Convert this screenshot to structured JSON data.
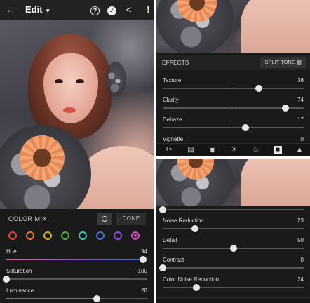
{
  "left": {
    "topbar": {
      "title": "Edit",
      "back_icon": "arrow-left-icon",
      "help_icon": "help-circle-icon",
      "check_icon": "check-circle-icon",
      "share_icon": "share-icon",
      "menu_icon": "more-vertical-icon"
    },
    "color_mix": {
      "title": "COLOR MIX",
      "done_label": "DONE",
      "swatch_colors": [
        "#e0443a",
        "#e5782e",
        "#d6b02a",
        "#4eaa3a",
        "#39c4c0",
        "#3a6ee0",
        "#8e4ee0",
        "#d64cc4"
      ],
      "selected_index": 7
    },
    "sliders": [
      {
        "label": "Hue",
        "value": "94",
        "pos": 0.97
      },
      {
        "label": "Saturation",
        "value": "-100",
        "pos": 0.0
      },
      {
        "label": "Luminance",
        "value": "28",
        "pos": 0.64
      }
    ]
  },
  "right_top": {
    "section_title": "EFFECTS",
    "split_tone_label": "SPLIT TONE",
    "sliders": [
      {
        "label": "Texture",
        "value": "36",
        "pos": 0.68
      },
      {
        "label": "Clarity",
        "value": "74",
        "pos": 0.87
      },
      {
        "label": "Dehaze",
        "value": "17",
        "pos": 0.585
      },
      {
        "label": "Vignette",
        "value": "0",
        "pos": 0.5
      }
    ],
    "tool_icons": [
      "crop-icon",
      "presets-icon",
      "photo-icon",
      "light-icon",
      "color-temperature-icon",
      "effects-icon",
      "detail-icon"
    ]
  },
  "right_bottom": {
    "sliders": [
      {
        "label": "Noise Reduction",
        "value": "23",
        "pos": 0.23
      },
      {
        "label": "Detail",
        "value": "50",
        "pos": 0.5
      },
      {
        "label": "Contrast",
        "value": "0",
        "pos": 0.0
      },
      {
        "label": "Color Noise Reduction",
        "value": "24",
        "pos": 0.24
      }
    ]
  }
}
